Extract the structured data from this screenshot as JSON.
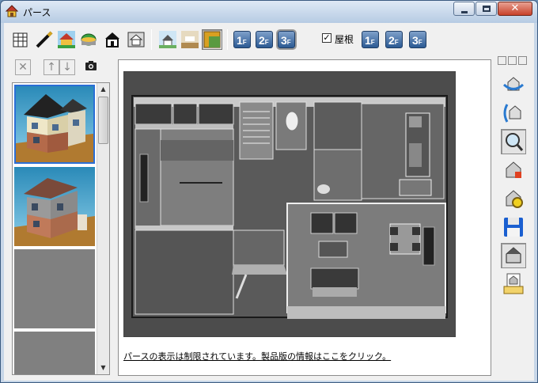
{
  "window": {
    "title": "パース",
    "close_glyph": "✕"
  },
  "toolbar": {
    "buttons": [
      {
        "id": "building",
        "icon": "building-icon"
      },
      {
        "id": "pen",
        "icon": "pen-icon"
      },
      {
        "id": "house-color",
        "icon": "house-color-icon"
      },
      {
        "id": "terrain",
        "icon": "terrain-icon"
      },
      {
        "id": "house-black",
        "icon": "house-black-icon"
      },
      {
        "id": "floorplan-doc",
        "icon": "floorplan-doc-icon"
      },
      {
        "id": "house-small",
        "icon": "house-small-icon"
      },
      {
        "id": "room",
        "icon": "room-icon"
      },
      {
        "id": "tile",
        "icon": "tile-icon"
      }
    ],
    "floors_left": [
      {
        "num": "1",
        "suffix": "F"
      },
      {
        "num": "2",
        "suffix": "F"
      },
      {
        "num": "3",
        "suffix": "F"
      }
    ],
    "roof_checked_glyph": "✓",
    "roof_label": "屋根",
    "floors_right": [
      {
        "num": "1",
        "suffix": "F"
      },
      {
        "num": "2",
        "suffix": "F"
      },
      {
        "num": "3",
        "suffix": "F"
      }
    ]
  },
  "left_toolbar": {
    "delete": "✕",
    "up": "↑",
    "down": "↓"
  },
  "thumbnails": {
    "up_arrow": "▲",
    "down_arrow": "▼"
  },
  "view": {
    "notice": "パースの表示は制限されています。製品版の情報はここをクリック。"
  },
  "colors": {
    "accent": "#2b6fd6",
    "floor_button": "#2c5a93",
    "viewport_bg": "#4e4e4e"
  }
}
